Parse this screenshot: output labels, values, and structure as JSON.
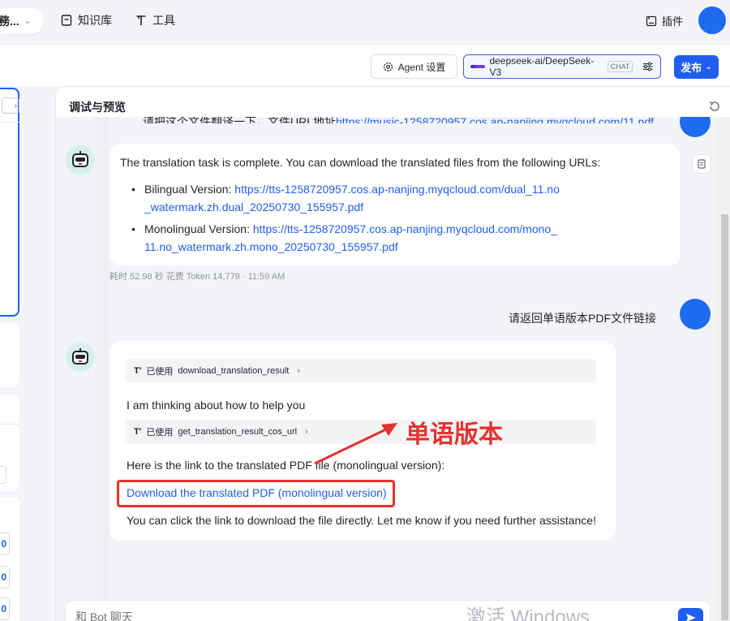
{
  "topbar": {
    "workspace_label": "務...",
    "nav": [
      {
        "label": "知识库",
        "icon": "book-icon"
      },
      {
        "label": "工具",
        "icon": "tool-icon"
      }
    ],
    "plugin_label": "插件"
  },
  "toolbar": {
    "agent_settings": "Agent 设置",
    "model_name": "deepseek-ai/DeepSeek-V3",
    "model_tag": "CHAT",
    "publish": "发布"
  },
  "preview": {
    "title": "调试与预览",
    "truncated_top_text": "请把这个文件翻译一下，文件URL地址",
    "truncated_top_link": "https://music-1258720957.cos.ap-nanjing.myqcloud.com/11.pdf",
    "messages": {
      "bot1": {
        "intro": "The translation task is complete. You can download the translated files from the following URLs:",
        "items": [
          {
            "label": "Bilingual Version: ",
            "url": "https://tts-1258720957.cos.ap-nanjing.myqcloud.com/dual_11.no_watermark.zh.dual_20250730_155957.pdf"
          },
          {
            "label": "Monolingual Version: ",
            "url": "https://tts-1258720957.cos.ap-nanjing.myqcloud.com/mono_11.no_watermark.zh.mono_20250730_155957.pdf"
          }
        ],
        "meta": "耗时 52.98 秒   花费 Token 14,779   ·   11:59 AM"
      },
      "user2": "请返回单语版本PDF文件链接",
      "bot2": {
        "tool1_prefix": "已使用",
        "tool1_name": "download_translation_result",
        "thinking": "I am thinking about how to help you",
        "tool2_prefix": "已使用",
        "tool2_name": "get_translation_result_cos_url",
        "link_intro": "Here is the link to the translated PDF file (monolingual version):",
        "link_text": "Download the translated PDF (monolingual version)",
        "closing": "You can click the link to download the file directly. Let me know if you need further assistance!"
      }
    },
    "annotation": "单语版本",
    "input_placeholder": "和 Bot 聊天",
    "watermark": "激活 Windows"
  },
  "colors": {
    "accent": "#1f5ef0",
    "annotation_red": "#e5322d"
  }
}
